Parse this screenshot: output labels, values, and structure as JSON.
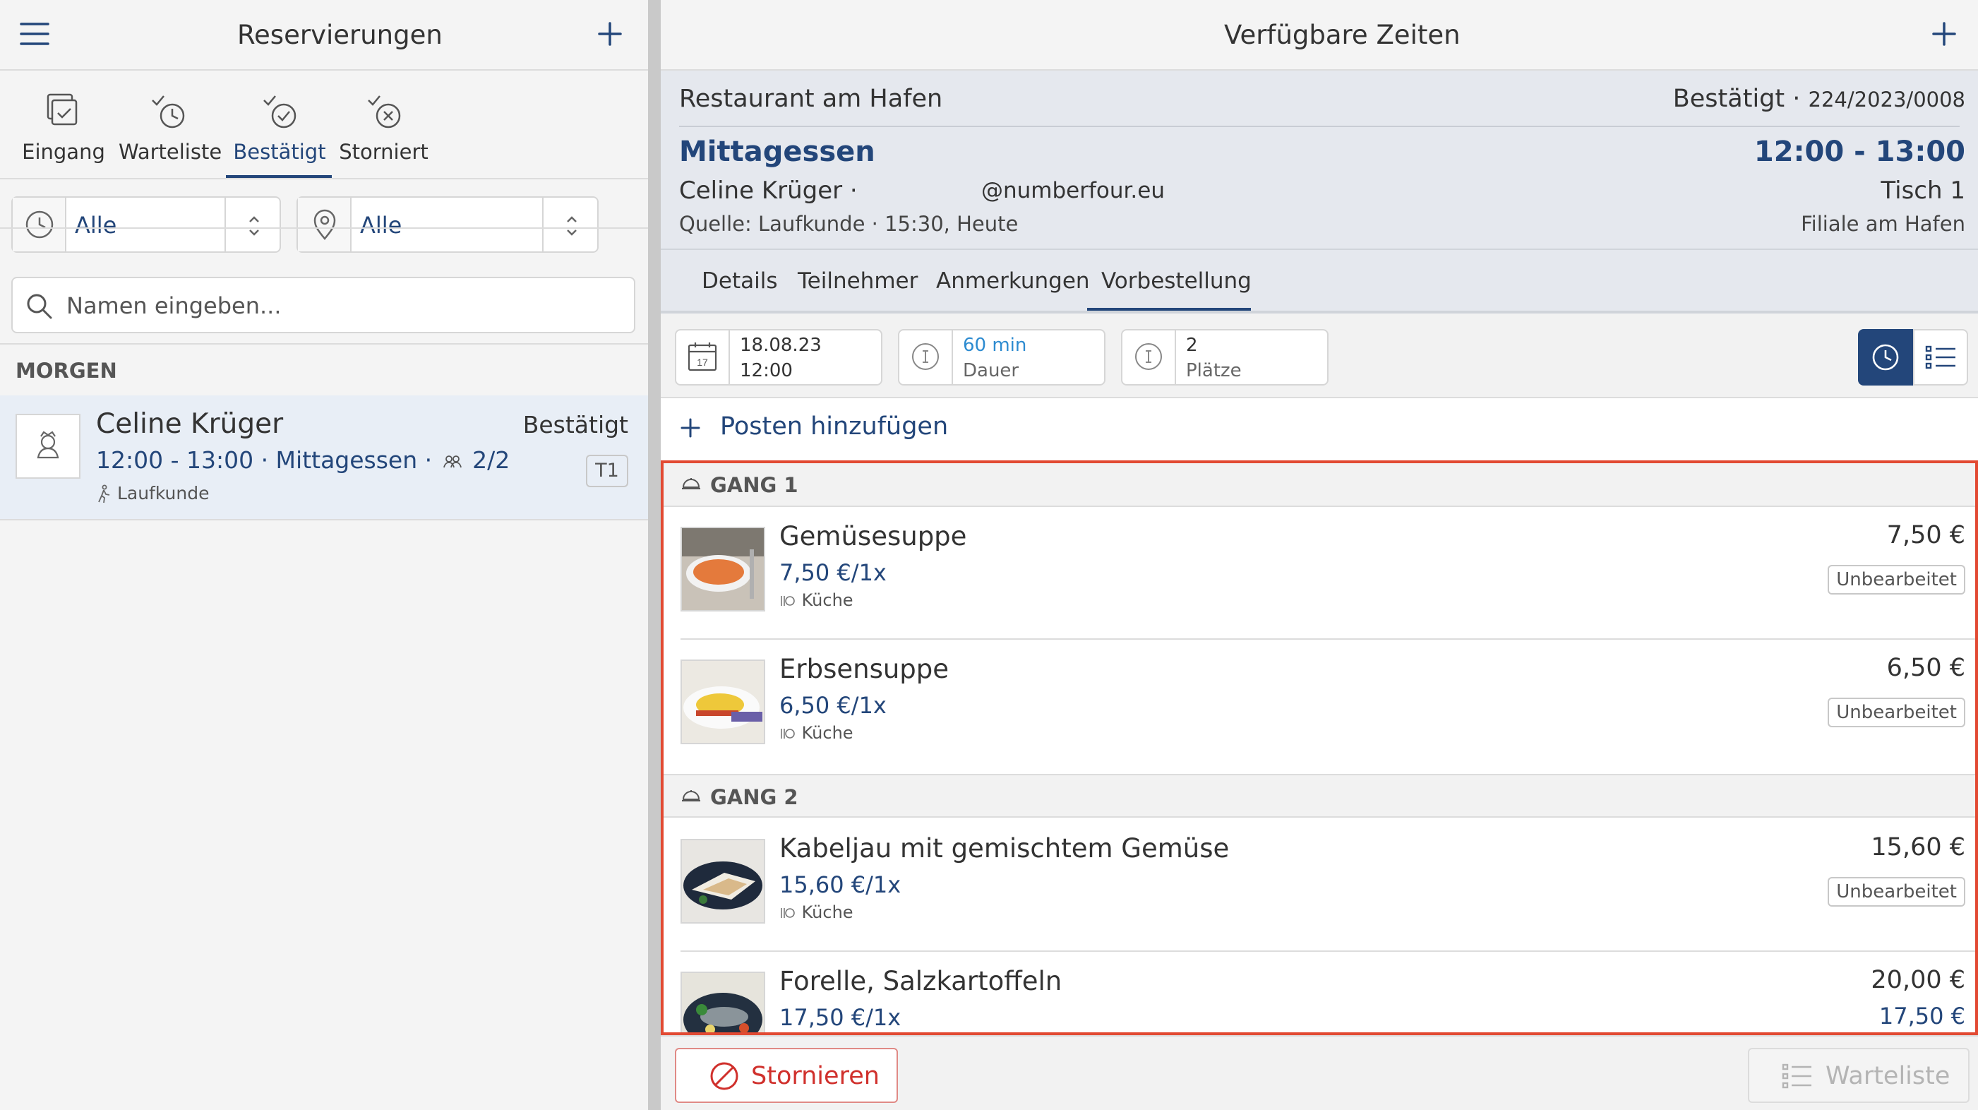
{
  "left": {
    "title": "Reservierungen",
    "categories": [
      {
        "label": "Eingang",
        "icon": "inbox-icon"
      },
      {
        "label": "Warteliste",
        "icon": "waitlist-clock-icon"
      },
      {
        "label": "Bestätigt",
        "icon": "confirmed-check-icon"
      },
      {
        "label": "Storniert",
        "icon": "cancelled-x-icon"
      }
    ],
    "active_category": "Bestätigt",
    "filter_time": "Alle",
    "filter_location": "Alle",
    "search_placeholder": "Namen eingeben...",
    "section": "MORGEN",
    "reservation": {
      "name": "Celine Krüger",
      "status": "Bestätigt",
      "details": "12:00 - 13:00 · Mittagessen ·",
      "guests": "2/2",
      "source": "Laufkunde",
      "table": "T1"
    }
  },
  "right": {
    "title": "Verfügbare Zeiten",
    "restaurant": "Restaurant am Hafen",
    "status": "Bestätigt ·",
    "booking_no": "224/2023/0008",
    "meal": "Mittagessen",
    "time": "12:00 - 13:00",
    "guest": "Celine Krüger ·",
    "email": "@numberfour.eu",
    "table": "Tisch 1",
    "source": "Quelle: Laufkunde · 15:30, Heute",
    "branch": "Filiale am Hafen",
    "tabs": [
      "Details",
      "Teilnehmer",
      "Anmerkungen",
      "Vorbestellung"
    ],
    "active_tab": "Vorbestellung",
    "date": "18.08.23",
    "date_time": "12:00",
    "calendar_day": "17",
    "duration": "60 min",
    "duration_label": "Dauer",
    "seats": "2",
    "seats_label": "Plätze",
    "add_item": "Posten hinzufügen",
    "gangs": [
      {
        "label": "GANG 1"
      },
      {
        "label": "GANG 2"
      }
    ],
    "dishes": [
      {
        "name": "Gemüsesuppe",
        "unit": "7,50 €/1x",
        "station": "Küche",
        "price": "7,50 €",
        "badge": "Unbearbeitet"
      },
      {
        "name": "Erbsensuppe",
        "unit": "6,50 €/1x",
        "station": "Küche",
        "price": "6,50 €",
        "badge": "Unbearbeitet"
      },
      {
        "name": "Kabeljau mit gemischtem Gemüse",
        "unit": "15,60 €/1x",
        "station": "Küche",
        "price": "15,60 €",
        "badge": "Unbearbeitet"
      },
      {
        "name": "Forelle, Salzkartoffeln",
        "unit": "17,50 €/1x",
        "price": "20,00 €",
        "price2": "17,50 €"
      }
    ],
    "cancel_button": "Stornieren",
    "waitlist_button": "Warteliste"
  },
  "colors": {
    "accent": "#23467a",
    "highlight": "#e24a33",
    "cancel": "#d0302c",
    "link_blue": "#2d8bd0"
  }
}
